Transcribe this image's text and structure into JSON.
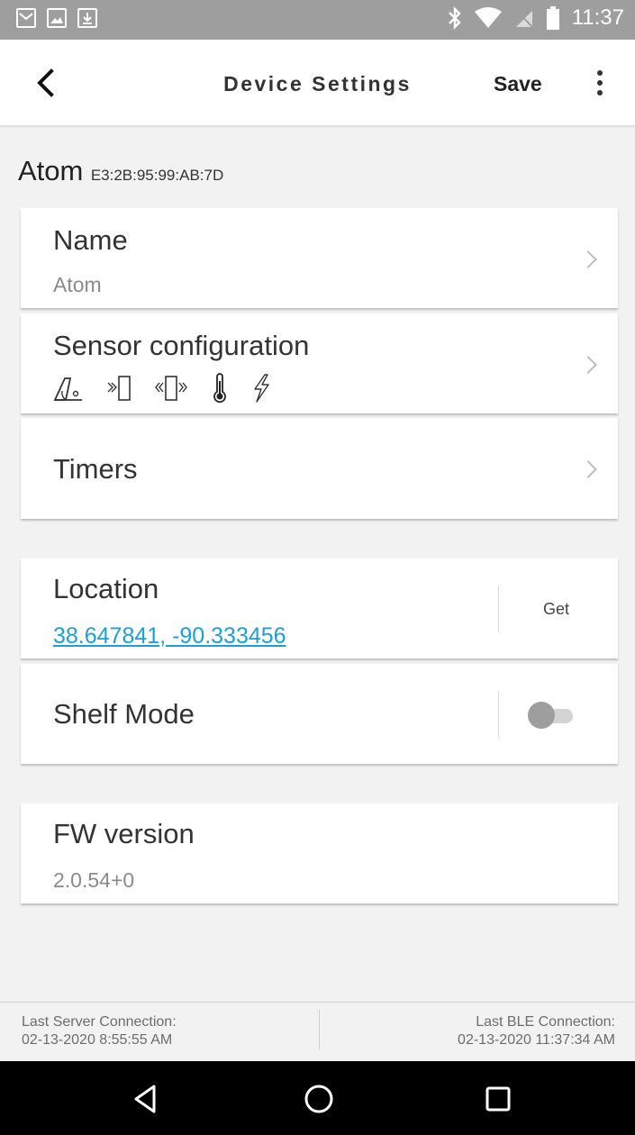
{
  "status_bar": {
    "time": "11:37",
    "left_icons": [
      "gmail-icon",
      "image-icon",
      "download-icon"
    ],
    "right_icons": [
      "bluetooth-icon",
      "wifi-icon",
      "no-sim-icon",
      "battery-icon"
    ]
  },
  "app_bar": {
    "title": "Device Settings",
    "save_label": "Save",
    "back_icon": "chevron-left-icon",
    "more_icon": "more-vertical-icon"
  },
  "device": {
    "name": "Atom",
    "mac": "E3:2B:95:99:AB:7D"
  },
  "settings": {
    "name": {
      "label": "Name",
      "value": "Atom"
    },
    "sensor_configuration": {
      "label": "Sensor configuration",
      "icons": [
        "tilt-icon",
        "proximity-icon",
        "vibration-icon",
        "thermometer-icon",
        "lightning-icon"
      ]
    },
    "timers": {
      "label": "Timers"
    },
    "location": {
      "label": "Location",
      "value": "38.647841, -90.333456",
      "button_label": "Get"
    },
    "shelf_mode": {
      "label": "Shelf Mode",
      "enabled": false
    },
    "fw_version": {
      "label": "FW version",
      "value": "2.0.54+0"
    }
  },
  "footer": {
    "server_label": "Last Server Connection:",
    "server_time": "02-13-2020 8:55:55 AM",
    "ble_label": "Last BLE Connection:",
    "ble_time": "02-13-2020 11:37:34 AM"
  },
  "nav_bar": {
    "back_icon": "triangle-back-icon",
    "home_icon": "circle-home-icon",
    "recents_icon": "square-recents-icon"
  },
  "colors": {
    "link": "#1a9fd9",
    "status_bar": "#9e9e9e",
    "background": "#f2f2f2"
  }
}
